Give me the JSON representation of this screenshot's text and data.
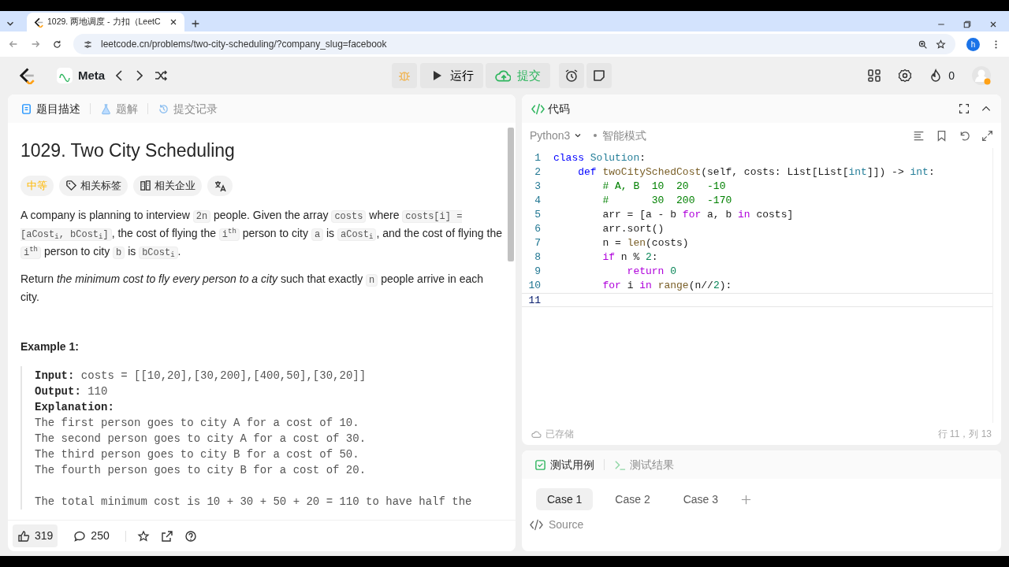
{
  "browser": {
    "tab_title": "1029. 两地调度 - 力扣（LeetC",
    "address": "leetcode.cn/problems/two-city-scheduling/?company_slug=facebook",
    "profile_initial": "h"
  },
  "header": {
    "list_name": "Meta",
    "run_label": "运行",
    "submit_label": "提交",
    "streak": "0"
  },
  "left_tabs": [
    {
      "label": "题目描述",
      "selected": true
    },
    {
      "label": "题解",
      "selected": false
    },
    {
      "label": "提交记录",
      "selected": false
    }
  ],
  "problem": {
    "title": "1029. Two City Scheduling",
    "difficulty": "中等",
    "tags": [
      "相关标签",
      "相关企业"
    ],
    "paragraphs": [
      [
        {
          "kind": "text",
          "text": "A company is planning to interview "
        },
        {
          "kind": "code",
          "text": "2n"
        },
        {
          "kind": "text",
          "text": " people. Given the array "
        },
        {
          "kind": "code",
          "text": "costs"
        },
        {
          "kind": "text",
          "text": " where "
        },
        {
          "kind": "code",
          "text": "costs[i] = [aCost$_{i}$, bCost$_{i}$]"
        },
        {
          "kind": "text",
          "text": ", the cost of flying the "
        },
        {
          "kind": "code",
          "text": "i$^{th}$"
        },
        {
          "kind": "text",
          "text": " person to city "
        },
        {
          "kind": "code",
          "text": "a"
        },
        {
          "kind": "text",
          "text": " is "
        },
        {
          "kind": "code",
          "text": "aCost$_{i}$"
        },
        {
          "kind": "text",
          "text": ", and the cost of flying the "
        },
        {
          "kind": "code",
          "text": "i$^{th}$"
        },
        {
          "kind": "text",
          "text": " person to city "
        },
        {
          "kind": "code",
          "text": "b"
        },
        {
          "kind": "text",
          "text": " is "
        },
        {
          "kind": "code",
          "text": "bCost$_{i}$"
        },
        {
          "kind": "text",
          "text": "."
        }
      ],
      [
        {
          "kind": "text",
          "text": "Return "
        },
        {
          "kind": "em",
          "text": "the minimum cost to fly every person to a city"
        },
        {
          "kind": "text",
          "text": " such that exactly "
        },
        {
          "kind": "code",
          "text": "n"
        },
        {
          "kind": "text",
          "text": " people arrive in each"
        },
        {
          "kind": "text",
          "text": " city."
        }
      ]
    ],
    "example_title": "Example 1:",
    "example_fields": [
      {
        "label": "Input:",
        "value": "costs = [[10,20],[30,200],[400,50],[30,20]]"
      },
      {
        "label": "Output:",
        "value": "110"
      },
      {
        "label": "Explanation:"
      }
    ],
    "explanation": [
      "The first person goes to city A for a cost of 10.",
      "The second person goes to city A for a cost of 30.",
      "The third person goes to city B for a cost of 50.",
      "The fourth person goes to city B for a cost of 20."
    ],
    "summary": "The total minimum cost is 10 + 30 + 50 + 20 = 110 to have half the"
  },
  "footer": {
    "likes": "319",
    "comments": "250"
  },
  "code_panel": {
    "title": "代码",
    "language": "Python3",
    "mode": "智能模式",
    "saved": "已存储",
    "cursor": "行 11，列 13",
    "lines": [
      {
        "number": "1",
        "current": false,
        "tokens": [
          {
            "kind": "kw",
            "text": "class "
          },
          {
            "kind": "cls",
            "text": "Solution"
          },
          {
            "kind": "p",
            "text": ":"
          }
        ]
      },
      {
        "number": "2",
        "current": false,
        "tokens": [
          {
            "kind": "kw",
            "text": "    def "
          },
          {
            "kind": "fn",
            "text": "twoCitySchedCost"
          },
          {
            "kind": "p",
            "text": "(self, costs: List[List["
          },
          {
            "kind": "cls",
            "text": "int"
          },
          {
            "kind": "p",
            "text": "]]) -> "
          },
          {
            "kind": "cls",
            "text": "int"
          },
          {
            "kind": "p",
            "text": ":"
          }
        ]
      },
      {
        "number": "3",
        "current": false,
        "tokens": [
          {
            "kind": "cm",
            "text": "        # A, B  10  20   -10"
          }
        ]
      },
      {
        "number": "4",
        "current": false,
        "tokens": [
          {
            "kind": "cm",
            "text": "        #       30  200  -170"
          }
        ]
      },
      {
        "number": "5",
        "current": false,
        "tokens": [
          {
            "kind": "p",
            "text": "        arr = [a - b "
          },
          {
            "kind": "ctl",
            "text": "for"
          },
          {
            "kind": "p",
            "text": " a, b "
          },
          {
            "kind": "ctl",
            "text": "in"
          },
          {
            "kind": "p",
            "text": " costs]"
          }
        ]
      },
      {
        "number": "6",
        "current": false,
        "tokens": [
          {
            "kind": "p",
            "text": "        arr.sort()"
          }
        ]
      },
      {
        "number": "7",
        "current": false,
        "tokens": [
          {
            "kind": "p",
            "text": "        n = "
          },
          {
            "kind": "fn",
            "text": "len"
          },
          {
            "kind": "p",
            "text": "(costs)"
          }
        ]
      },
      {
        "number": "8",
        "current": false,
        "tokens": [
          {
            "kind": "ctl",
            "text": "        if"
          },
          {
            "kind": "p",
            "text": " n % "
          },
          {
            "kind": "num",
            "text": "2"
          },
          {
            "kind": "p",
            "text": ":"
          }
        ]
      },
      {
        "number": "9",
        "current": false,
        "tokens": [
          {
            "kind": "ctl",
            "text": "            return "
          },
          {
            "kind": "num",
            "text": "0"
          }
        ]
      },
      {
        "number": "10",
        "current": false,
        "tokens": [
          {
            "kind": "ctl",
            "text": "        for"
          },
          {
            "kind": "p",
            "text": " i "
          },
          {
            "kind": "ctl",
            "text": "in"
          },
          {
            "kind": "fn",
            "text": " range"
          },
          {
            "kind": "p",
            "text": "(n//"
          },
          {
            "kind": "num",
            "text": "2"
          },
          {
            "kind": "p",
            "text": "):"
          }
        ]
      },
      {
        "number": "11",
        "current": true
      }
    ]
  },
  "test_tabs": [
    {
      "label": "测试用例",
      "selected": true
    },
    {
      "label": "测试结果",
      "selected": false
    }
  ],
  "cases": [
    {
      "label": "Case 1",
      "selected": true
    },
    {
      "label": "Case 2",
      "selected": false
    },
    {
      "label": "Case 3",
      "selected": false
    }
  ],
  "source_label": "Source"
}
